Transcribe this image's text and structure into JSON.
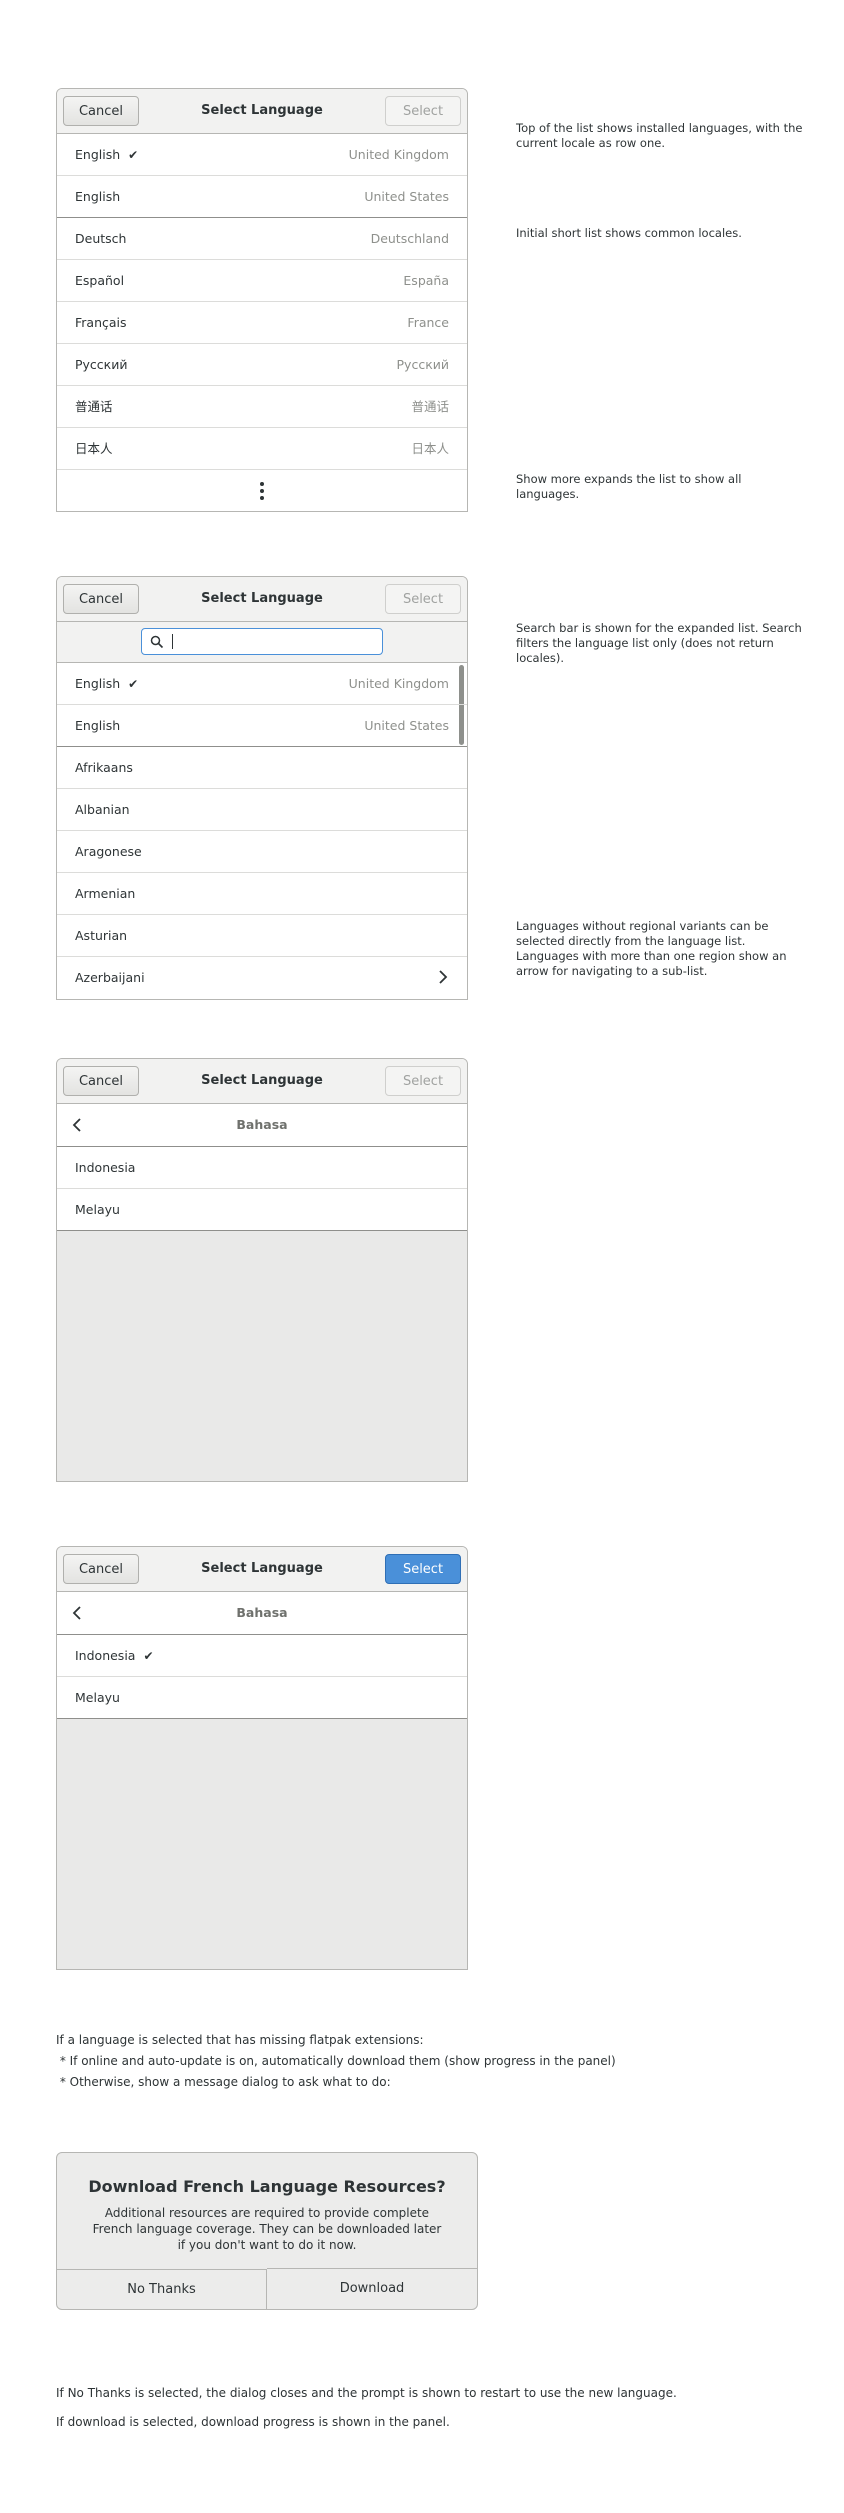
{
  "common": {
    "cancel": "Cancel",
    "title": "Select Language",
    "select": "Select"
  },
  "dialog1": {
    "rows": [
      {
        "label": "English",
        "region": "United Kingdom"
      },
      {
        "label": "English",
        "region": "United States"
      },
      {
        "label": "Deutsch",
        "region": "Deutschland"
      },
      {
        "label": "Español",
        "region": "España"
      },
      {
        "label": "Français",
        "region": "France"
      },
      {
        "label": "Русский",
        "region": "Русский"
      },
      {
        "label": "普通话",
        "region": "普通话"
      },
      {
        "label": "日本人",
        "region": "日本人"
      }
    ]
  },
  "dialog2": {
    "rows": [
      {
        "label": "English",
        "region": "United Kingdom"
      },
      {
        "label": "English",
        "region": "United States"
      },
      {
        "label": "Afrikaans"
      },
      {
        "label": "Albanian"
      },
      {
        "label": "Aragonese"
      },
      {
        "label": "Armenian"
      },
      {
        "label": "Asturian"
      },
      {
        "label": "Azerbaijani"
      }
    ]
  },
  "dialog3": {
    "back_title": "Bahasa",
    "rows": [
      {
        "label": "Indonesia"
      },
      {
        "label": "Melayu"
      }
    ]
  },
  "dialog4": {
    "back_title": "Bahasa",
    "rows": [
      {
        "label": "Indonesia"
      },
      {
        "label": "Melayu"
      }
    ]
  },
  "notes": {
    "n1": "Top of the list shows installed languages, with the current locale as row one.",
    "n2": "Initial short list shows common locales.",
    "n3": "Show more expands the list to show all languages.",
    "n4": "Search bar is shown for the expanded list. Search filters the language list only (does not return locales).",
    "n5": "Languages without regional variants can be selected directly from the language list. Languages with more than one region show an arrow for navigating to a sub-list."
  },
  "flatpak": {
    "line1": "If a language is selected that has missing flatpak extensions:",
    "line2": " * If online and auto-update is on, automatically download them (show progress in the panel)",
    "line3": " * Otherwise, show a message dialog to ask what to do:"
  },
  "modal": {
    "title": "Download French Language Resources?",
    "body": "Additional resources are required to provide complete French language coverage. They can be downloaded later if you don't want to do it now.",
    "no_thanks": "No Thanks",
    "download": "Download"
  },
  "footer": {
    "line1": "If No Thanks is selected, the dialog closes and the prompt is shown to restart to use the new language.",
    "line2": "If download is selected, download progress is shown in the panel."
  }
}
